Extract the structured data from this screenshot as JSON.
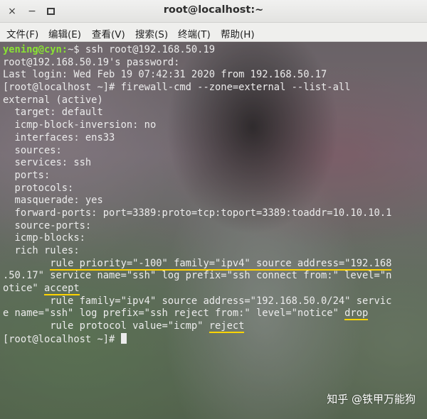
{
  "window": {
    "title": "root@localhost:~",
    "controls": {
      "close": "×",
      "minimize": "−",
      "maximize": ""
    }
  },
  "menu": [
    "文件(F)",
    "编辑(E)",
    "查看(V)",
    "搜索(S)",
    "终端(T)",
    "帮助(H)"
  ],
  "terminal": {
    "colors": {
      "user_prompt": "#8ae234",
      "text": "#ececec",
      "underline": "#ffd400"
    },
    "lines": [
      {
        "segments": [
          {
            "text": "yening@cyn:",
            "style": "prompt-green"
          },
          {
            "text": "~$ ssh root@192.168.50.19"
          }
        ]
      },
      {
        "segments": [
          {
            "text": "root@192.168.50.19's password:"
          }
        ]
      },
      {
        "segments": [
          {
            "text": "Last login: Wed Feb 19 07:42:31 2020 from 192.168.50.17"
          }
        ]
      },
      {
        "segments": [
          {
            "text": "[root@localhost ~]# firewall-cmd --zone=external --list-all"
          }
        ]
      },
      {
        "segments": [
          {
            "text": "external (active)"
          }
        ]
      },
      {
        "segments": [
          {
            "text": "  target: default"
          }
        ]
      },
      {
        "segments": [
          {
            "text": "  icmp-block-inversion: no"
          }
        ]
      },
      {
        "segments": [
          {
            "text": "  interfaces: ens33"
          }
        ]
      },
      {
        "segments": [
          {
            "text": "  sources:"
          }
        ]
      },
      {
        "segments": [
          {
            "text": "  services: ssh"
          }
        ]
      },
      {
        "segments": [
          {
            "text": "  ports:"
          }
        ]
      },
      {
        "segments": [
          {
            "text": "  protocols:"
          }
        ]
      },
      {
        "segments": [
          {
            "text": "  masquerade: yes"
          }
        ]
      },
      {
        "segments": [
          {
            "text": "  forward-ports: port=3389:proto=tcp:toport=3389:toaddr=10.10.10.1"
          }
        ]
      },
      {
        "segments": [
          {
            "text": "  source-ports:"
          }
        ]
      },
      {
        "segments": [
          {
            "text": "  icmp-blocks:"
          }
        ]
      },
      {
        "segments": [
          {
            "text": "  rich rules:"
          }
        ]
      },
      {
        "segments": [
          {
            "text": "        "
          },
          {
            "text": "rule priority=\"-100\" family=\"ipv4\" source address=\"192.168",
            "style": "ul"
          }
        ]
      },
      {
        "segments": [
          {
            "text": ".50.17\" service name=\"ssh\" log prefix=\"ssh connect from:\" level=\"n"
          }
        ]
      },
      {
        "segments": [
          {
            "text": "otice\" "
          },
          {
            "text": "accept",
            "style": "ul"
          }
        ]
      },
      {
        "segments": [
          {
            "text": "        rule family=\"ipv4\" source address=\"192.168.50.0/24\" servic"
          }
        ]
      },
      {
        "segments": [
          {
            "text": "e name=\"ssh\" log prefix=\"ssh reject from:\" level=\"notice\" "
          },
          {
            "text": "drop",
            "style": "ul"
          }
        ]
      },
      {
        "segments": [
          {
            "text": "        rule protocol value=\"icmp\" "
          },
          {
            "text": "reject",
            "style": "ul"
          }
        ]
      },
      {
        "segments": [
          {
            "text": "[root@localhost ~]# "
          }
        ],
        "cursor": true
      }
    ]
  },
  "watermark": "知乎 @铁甲万能狗"
}
